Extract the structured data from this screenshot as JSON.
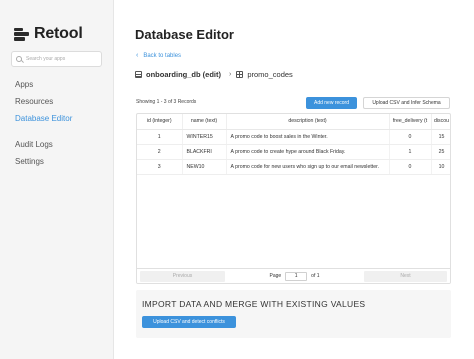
{
  "app": {
    "name": "Retool"
  },
  "sidebar": {
    "search_placeholder": "Search your apps",
    "items": [
      {
        "label": "Apps"
      },
      {
        "label": "Resources"
      },
      {
        "label": "Database Editor"
      },
      {
        "label": "Audit Logs"
      },
      {
        "label": "Settings"
      }
    ],
    "active_color": "#3c92dc"
  },
  "main": {
    "title": "Database Editor",
    "back_label": "Back to tables",
    "breadcrumb": {
      "database": "onboarding_db (edit)",
      "table": "promo_codes"
    },
    "records_text": "Showing 1 - 3 of 3 Records",
    "add_button": "Add new record",
    "upload_schema_button": "Upload CSV and Infer Schema"
  },
  "table": {
    "columns": [
      "id (integer)",
      "name (text)",
      "description (text)",
      "free_delivery (t",
      "discou"
    ],
    "rows": [
      [
        "1",
        "WINTER15",
        "A promo code to boost sales in the Winter.",
        "0",
        "15"
      ],
      [
        "2",
        "BLACKFRI",
        "A promo code to create hype around Black Friday.",
        "1",
        "25"
      ],
      [
        "3",
        "NEW10",
        "A promo code for new users who sign up to our email newsletter.",
        "0",
        "10"
      ]
    ]
  },
  "pagination": {
    "previous": "Previous",
    "page_label": "Page",
    "current_page": "1",
    "of_label": "of 1",
    "next": "Next"
  },
  "import": {
    "title": "IMPORT DATA AND MERGE WITH EXISTING VALUES",
    "button": "Upload CSV and detect conflicts"
  },
  "colors": {
    "accent": "#3c92dc",
    "sidebar_bg": "#f5f5f5"
  }
}
